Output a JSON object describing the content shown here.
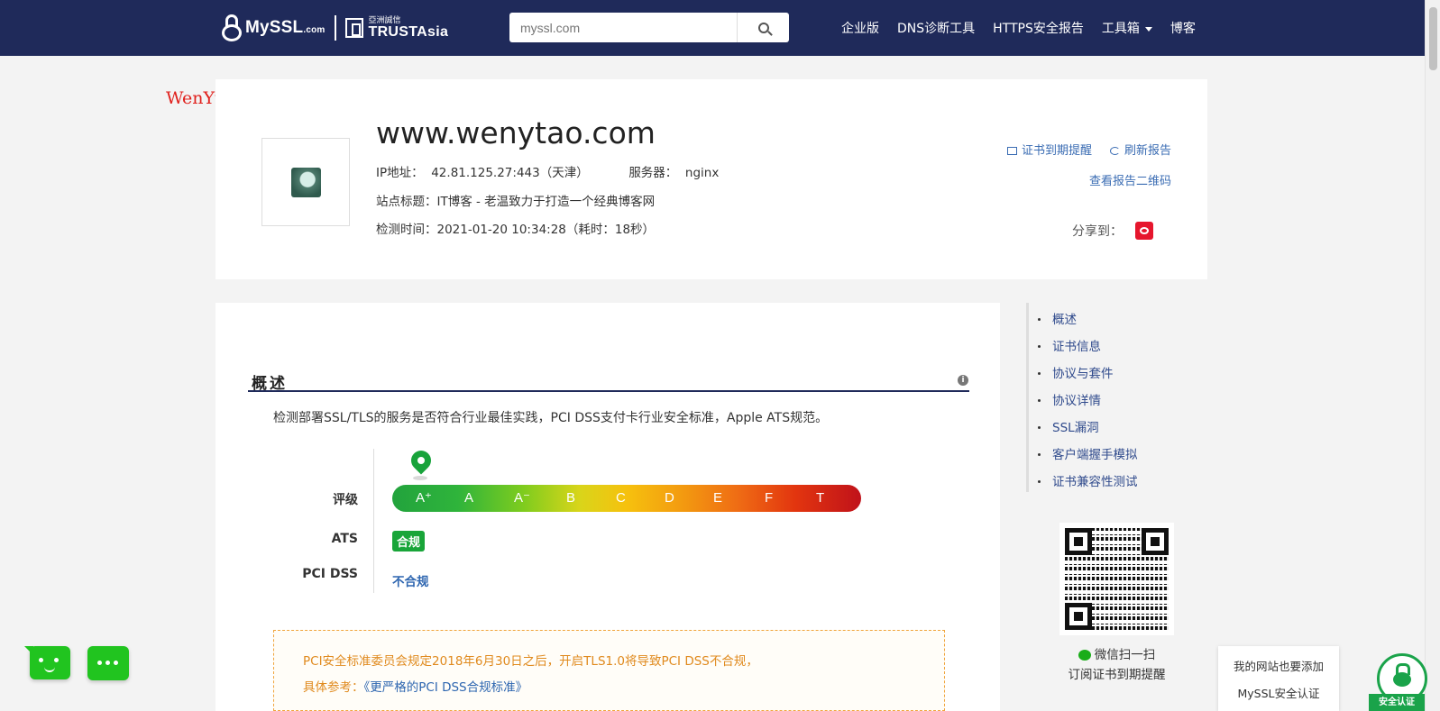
{
  "topbar": {
    "brand": "MySSL",
    "brand_suffix": ".com",
    "partner_cn": "亞洲誠信",
    "partner_en": "TRUSTAsia",
    "search_placeholder": "myssl.com",
    "nav": [
      "企业版",
      "DNS诊断工具",
      "HTTPS安全报告",
      "工具箱",
      "博客"
    ],
    "accent_color": "#1f2a5a"
  },
  "watermark": "WenYtao. Com",
  "report": {
    "domain": "www.wenytao.com",
    "ip_label": "IP地址：",
    "ip_value": "42.81.125.27:443（天津）",
    "server_label": "服务器：",
    "server_value": "nginx",
    "site_title_label": "站点标题：",
    "site_title_value": "IT博客 - 老温致力于打造一个经典博客网",
    "time_label": "检测时间：",
    "time_value": "2021-01-20 10:34:28（耗时：18秒）",
    "cert_reminder": "证书到期提醒",
    "refresh": "刷新报告",
    "qr_link": "查看报告二维码",
    "share_label": "分享到："
  },
  "overview": {
    "title": "概述",
    "description": "检测部署SSL/TLS的服务是否符合行业最佳实践，PCI DSS支付卡行业安全标准，Apple ATS规范。",
    "rating_label": "评级",
    "grades": [
      "A⁺",
      "A",
      "A⁻",
      "B",
      "C",
      "D",
      "E",
      "F",
      "T"
    ],
    "current_grade": "A⁺",
    "ats_label": "ATS",
    "ats_value": "合规",
    "pci_label": "PCI DSS",
    "pci_value": "不合规",
    "notice_line1": "PCI安全标准委员会规定2018年6月30日之后，开启TLS1.0将导致PCI DSS不合规，",
    "notice_line2_prefix": "具体参考：",
    "notice_link": "《更严格的PCI DSS合规标准》"
  },
  "side_nav": {
    "items": [
      "概述",
      "证书信息",
      "协议与套件",
      "协议详情",
      "SSL漏洞",
      "客户端握手模拟",
      "证书兼容性测试"
    ]
  },
  "qr_block": {
    "line1": "微信扫一扫",
    "line2": "订阅证书到期提醒"
  },
  "seal": {
    "popup_line1": "我的网站也要添加",
    "popup_line2": "MySSL安全认证",
    "label": "安全认证"
  }
}
